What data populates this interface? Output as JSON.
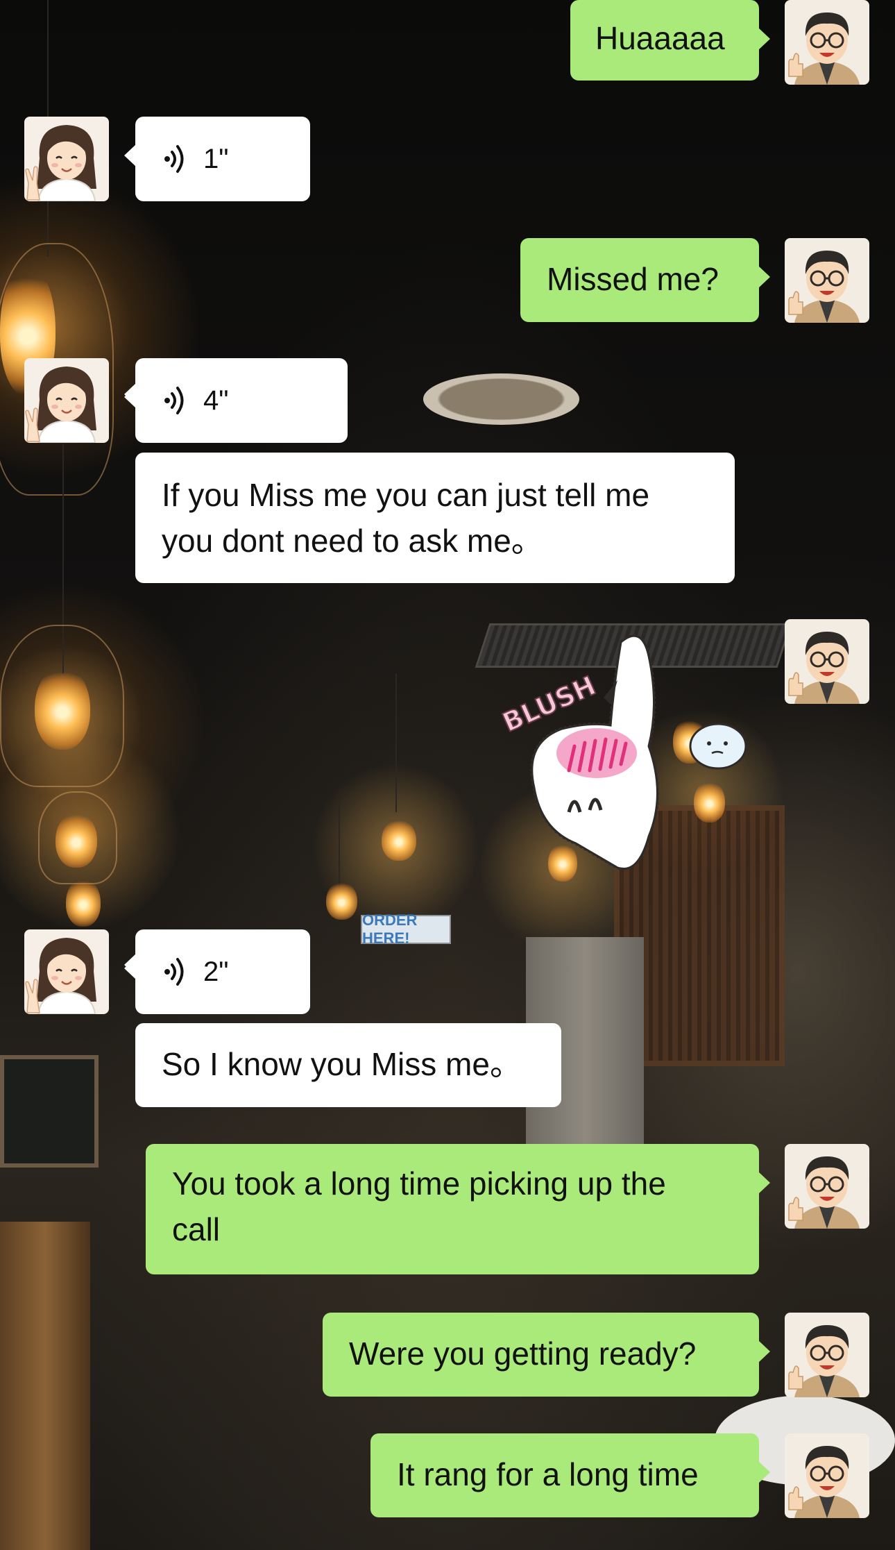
{
  "messages": [
    {
      "side": "me",
      "type": "text",
      "text": "Huaaaaa"
    },
    {
      "side": "her",
      "type": "voice",
      "duration": "1\""
    },
    {
      "side": "me",
      "type": "text",
      "text": "Missed me?"
    },
    {
      "side": "her",
      "type": "voice",
      "duration": "4\""
    },
    {
      "side": "her",
      "type": "text",
      "lines": [
        "If you Miss me you can just tell me",
        "you dont need to ask me。"
      ]
    },
    {
      "side": "me",
      "type": "sticker",
      "caption": "BLUSH",
      "icon": "blush-bunny-sticker"
    },
    {
      "side": "her",
      "type": "voice",
      "duration": "2\""
    },
    {
      "side": "her",
      "type": "text",
      "text": "So I know you Miss me。"
    },
    {
      "side": "me",
      "type": "text",
      "lines": [
        "You took a long time picking up the",
        "call"
      ]
    },
    {
      "side": "me",
      "type": "text",
      "text": "Were you getting ready?"
    },
    {
      "side": "me",
      "type": "text",
      "text": "It rang for a long time"
    }
  ],
  "background": {
    "sign_text": "ORDER HERE!"
  },
  "colors": {
    "my_bubble": "#a9ea7a",
    "her_bubble": "#ffffff"
  },
  "icons": {
    "my_avatar": "man-with-glasses-thumbs-up-avatar",
    "her_avatar": "woman-peace-sign-avatar",
    "voice": "sound-wave-icon"
  }
}
